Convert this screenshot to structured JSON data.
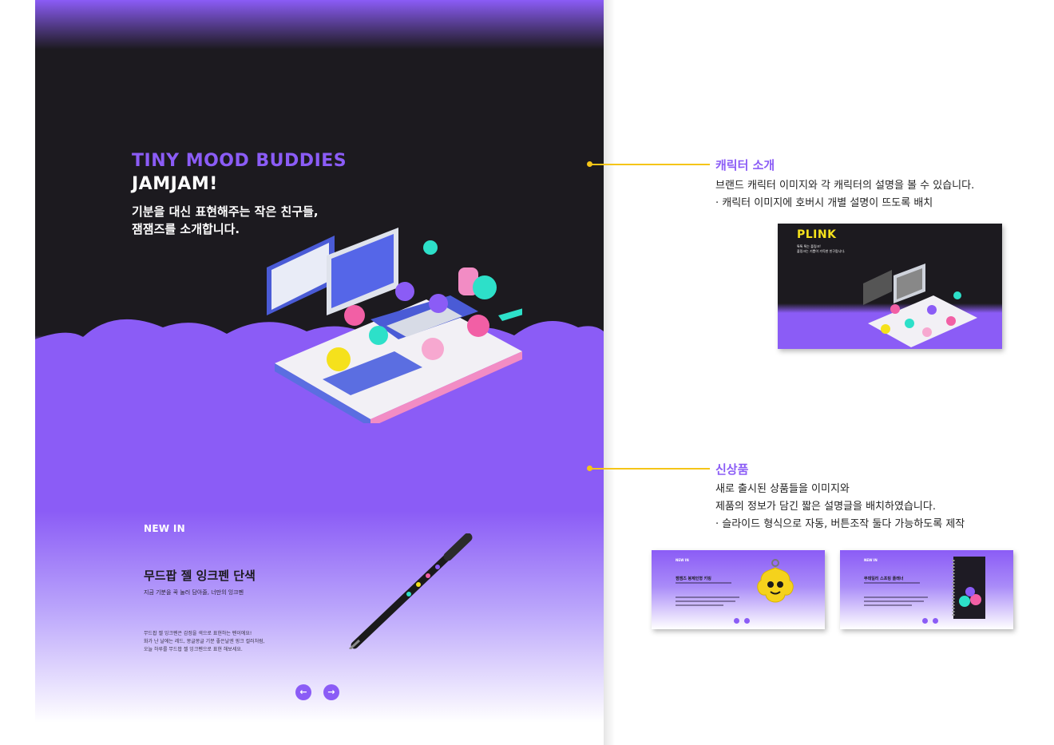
{
  "colors": {
    "accent": "#8b5cf6",
    "dark": "#1c1a1f",
    "highlight": "#f5c518"
  },
  "hero": {
    "brand_line1": "TINY MOOD BUDDIES",
    "brand_line2": "JAMJAM!",
    "desc_line1": "기분을 대신 표현해주는 작은 친구들,",
    "desc_line2": "잼잼즈를 소개합니다."
  },
  "product": {
    "tag": "NEW IN",
    "title": "무드팝 젤 잉크펜 단색",
    "subtitle": "지금 기분을 꾹 눌러 담아줄, 너만의 잉크펜",
    "body_line1": "무드팝 젤 잉크펜은 감정을 색으로 표현하는 펜이에요!",
    "body_line2": "화가 난 날에는 레드, 몽글몽글 기분 좋은날엔 핑크 컬러처럼,",
    "body_line3": "오늘 하루를 무드팝 젤 잉크펜으로 표현 해보세요.",
    "prev_icon": "arrow-left-icon",
    "next_icon": "arrow-right-icon",
    "prev_glyph": "←",
    "next_glyph": "→"
  },
  "annotations": [
    {
      "title": "캐릭터 소개",
      "lines": [
        "브랜드 캐릭터 이미지와 각 캐릭터의 설명을 볼 수 있습니다.",
        "· 캐릭터 이미지에 호버시 개별 설명이 뜨도록 배치"
      ]
    },
    {
      "title": "신상품",
      "lines": [
        "새로 출시된 상품들을 이미지와",
        "제품의 정보가 담긴 짧은 설명글을 배치하였습니다.",
        "· 슬라이드 형식으로 자동, 버튼조작 둘다 가능하도록 제작"
      ]
    }
  ],
  "thumbnails": {
    "character": {
      "title": "PLINK",
      "line1": "톡톡 튀는 플링크!",
      "line2": "플링크는 기쁨이 가득한 친구랍니다."
    },
    "product_a": {
      "tag": "NEW IN",
      "title": "잼잼즈 봉제인형 키링"
    },
    "product_b": {
      "tag": "NEW IN",
      "title": "무데일리 스프링 플래너"
    }
  }
}
